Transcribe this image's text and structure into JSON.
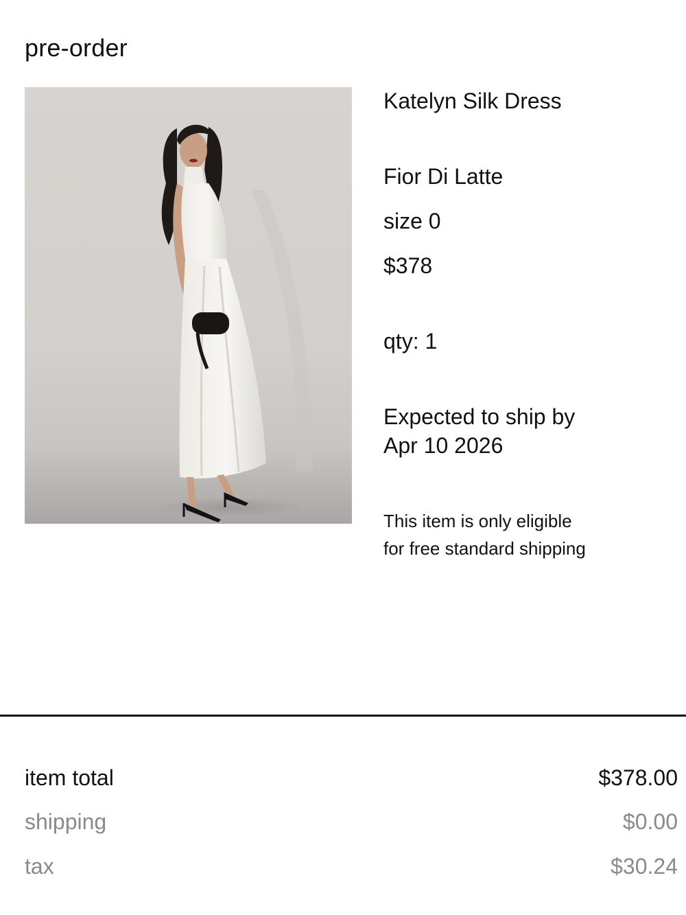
{
  "section": {
    "title": "pre-order"
  },
  "product": {
    "image_alt": "Katelyn Silk Dress",
    "name": "Katelyn Silk Dress",
    "color": "Fior Di Latte",
    "size": "size 0",
    "price": "$378",
    "qty": "qty: 1",
    "ship_line1": "Expected to ship by",
    "ship_line2": "Apr 10 2026",
    "note_line1": "This item is only eligible",
    "note_line2": "for free standard shipping"
  },
  "summary": {
    "item_total_label": "item total",
    "item_total_value": "$378.00",
    "shipping_label": "shipping",
    "shipping_value": "$0.00",
    "tax_label": "tax",
    "tax_value": "$30.24"
  },
  "colors": {
    "text_primary": "#111111",
    "text_muted": "#8a8a8a",
    "divider": "#111111",
    "image_background": "#d7d3d0"
  }
}
